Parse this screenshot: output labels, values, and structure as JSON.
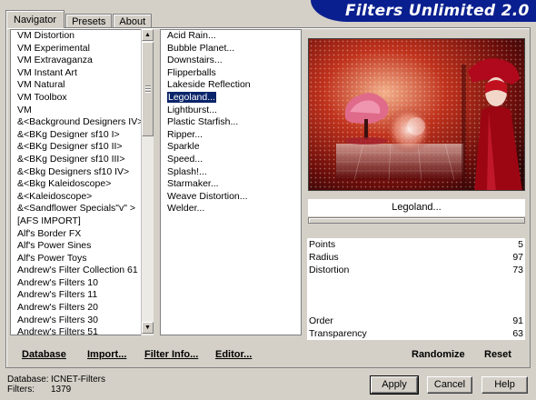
{
  "tabs": [
    {
      "label": "Navigator",
      "active": true
    },
    {
      "label": "Presets",
      "active": false
    },
    {
      "label": "About",
      "active": false
    }
  ],
  "banner": {
    "title": "Filters Unlimited 2.0"
  },
  "categories": [
    "VM Distortion",
    "VM Experimental",
    "VM Extravaganza",
    "VM Instant Art",
    "VM Natural",
    "VM Toolbox",
    "VM",
    "&<Background Designers IV>",
    "&<BKg Designer sf10 I>",
    "&<BKg Designer sf10 II>",
    "&<BKg Designer sf10 III>",
    "&<Bkg Designers sf10 IV>",
    "&<Bkg Kaleidoscope>",
    "&<Kaleidoscope>",
    "&<Sandflower Specials\"v\" >",
    "[AFS IMPORT]",
    "Alf's Border FX",
    "Alf's Power Sines",
    "Alf's Power Toys",
    "Andrew's Filter Collection 61",
    "Andrew's Filters 10",
    "Andrew's Filters 11",
    "Andrew's Filters 20",
    "Andrew's Filters 30",
    "Andrew's Filters 51"
  ],
  "filters": [
    "Acid Rain...",
    "Bubble Planet...",
    "Downstairs...",
    "Flipperballs",
    "Lakeside Reflection",
    "Legoland...",
    "Lightburst...",
    "Plastic Starfish...",
    "Ripper...",
    "Sparkle",
    "Speed...",
    "Splash!...",
    "Starmaker...",
    "Weave Distortion...",
    "Welder..."
  ],
  "selected_filter_index": 5,
  "current_filter": "Legoland...",
  "params": [
    {
      "name": "Points",
      "value": "5"
    },
    {
      "name": "Radius",
      "value": "97"
    },
    {
      "name": "Distortion",
      "value": "73"
    },
    {
      "name": "",
      "value": ""
    },
    {
      "name": "",
      "value": ""
    },
    {
      "name": "",
      "value": ""
    },
    {
      "name": "Order",
      "value": "91"
    },
    {
      "name": "Transparency",
      "value": "63"
    }
  ],
  "bottom_actions": {
    "database": "Database",
    "import": "Import...",
    "filter_info": "Filter Info...",
    "editor": "Editor...",
    "randomize": "Randomize",
    "reset": "Reset"
  },
  "status": {
    "database_label": "Database:",
    "database_value": "ICNET-Filters",
    "filters_label": "Filters:",
    "filters_value": "1379"
  },
  "buttons": {
    "apply": "Apply",
    "cancel": "Cancel",
    "help": "Help"
  },
  "colors": {
    "banner": "#0a1f8f",
    "selection": "#0a246a",
    "dialog": "#d4d0c8"
  }
}
